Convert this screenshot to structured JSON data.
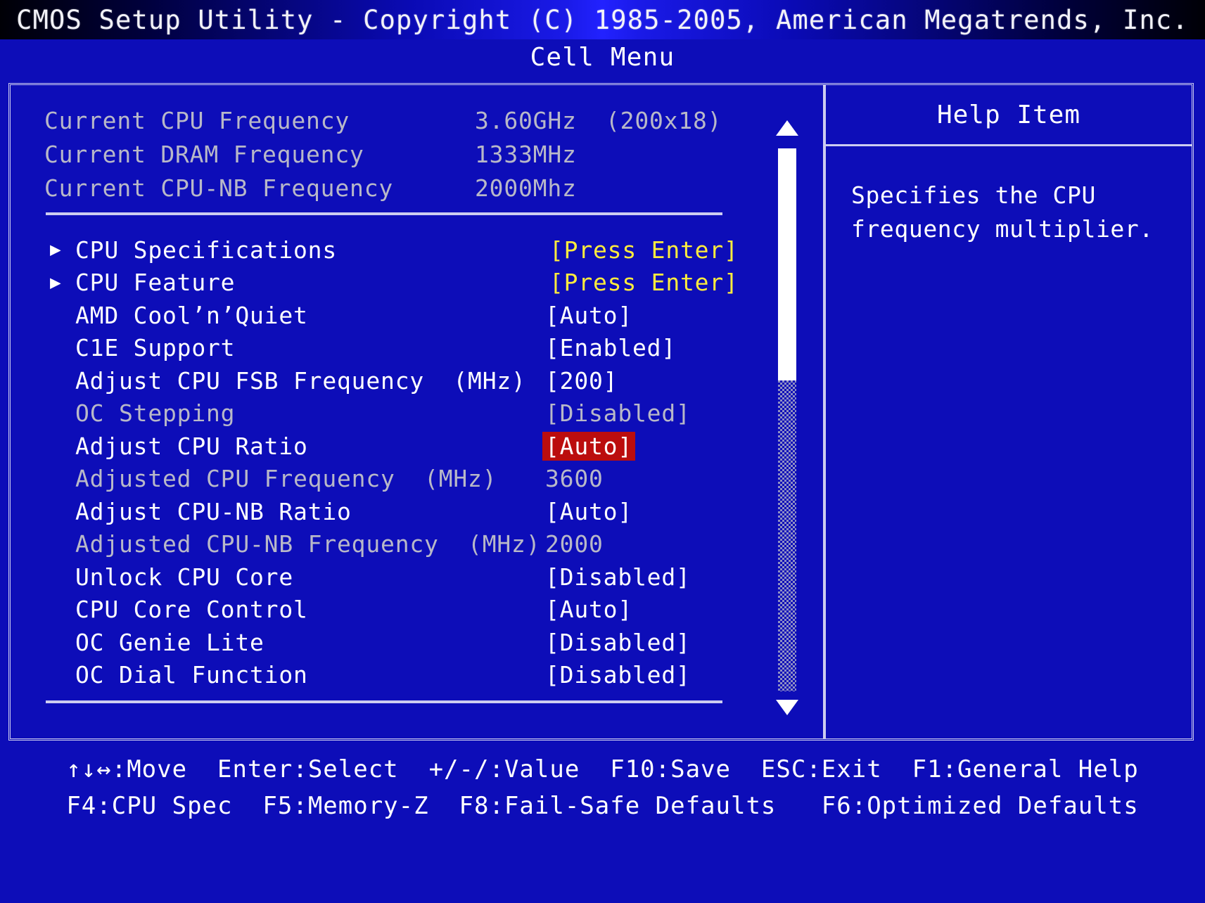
{
  "titlebar": {
    "title": "CMOS Setup Utility - Copyright (C) 1985-2005, American Megatrends, Inc."
  },
  "menu": {
    "name": "Cell Menu"
  },
  "info_rows": [
    {
      "label": "Current CPU Frequency",
      "value": "3.60GHz  (200x18)"
    },
    {
      "label": "Current DRAM Frequency",
      "value": "1333MHz"
    },
    {
      "label": "Current CPU-NB Frequency",
      "value": "2000Mhz"
    }
  ],
  "option_rows": [
    {
      "arrow": "▶",
      "label": "CPU Specifications",
      "value": "[Press Enter]",
      "state": "submenu"
    },
    {
      "arrow": "▶",
      "label": "CPU Feature",
      "value": "[Press Enter]",
      "state": "submenu"
    },
    {
      "arrow": "",
      "label": "AMD Cool’n’Quiet",
      "value": "[Auto]",
      "state": "normal"
    },
    {
      "arrow": "",
      "label": "C1E Support",
      "value": "[Enabled]",
      "state": "normal"
    },
    {
      "arrow": "",
      "label": "Adjust CPU FSB Frequency  (MHz)",
      "value": "[200]",
      "state": "normal"
    },
    {
      "arrow": "",
      "label": "OC Stepping",
      "value": "[Disabled]",
      "state": "dim"
    },
    {
      "arrow": "",
      "label": "Adjust CPU Ratio",
      "value": "[Auto]",
      "state": "selected"
    },
    {
      "arrow": "",
      "label": "Adjusted CPU Frequency  (MHz)",
      "value": "3600",
      "state": "dim"
    },
    {
      "arrow": "",
      "label": "Adjust CPU-NB Ratio",
      "value": "[Auto]",
      "state": "normal"
    },
    {
      "arrow": "",
      "label": "Adjusted CPU-NB Frequency  (MHz)",
      "value": "2000",
      "state": "dim"
    },
    {
      "arrow": "",
      "label": "Unlock CPU Core",
      "value": "[Disabled]",
      "state": "normal"
    },
    {
      "arrow": "",
      "label": "CPU Core Control",
      "value": "[Auto]",
      "state": "normal"
    },
    {
      "arrow": "",
      "label": "OC Genie Lite",
      "value": "[Disabled]",
      "state": "normal"
    },
    {
      "arrow": "",
      "label": "OC Dial Function",
      "value": "[Disabled]",
      "state": "normal"
    }
  ],
  "help": {
    "title": "Help Item",
    "lines": [
      "Specifies the CPU",
      "frequency multiplier."
    ]
  },
  "scrollbar": {
    "up_arrow": "▲",
    "down_arrow": "▼"
  },
  "footer": {
    "line1": "↑↓↔:Move  Enter:Select  +/-/:Value  F10:Save  ESC:Exit  F1:General Help",
    "line2": "F4:CPU Spec  F5:Memory-Z  F8:Fail-Safe Defaults   F6:Optimized Defaults"
  },
  "colors": {
    "background": "#0d0db8",
    "border": "#ccccf0",
    "text": "#ffffff",
    "dim_text": "#b8b8c8",
    "submenu_value": "#ffec3d",
    "selection_bg": "#bb0d0d"
  }
}
